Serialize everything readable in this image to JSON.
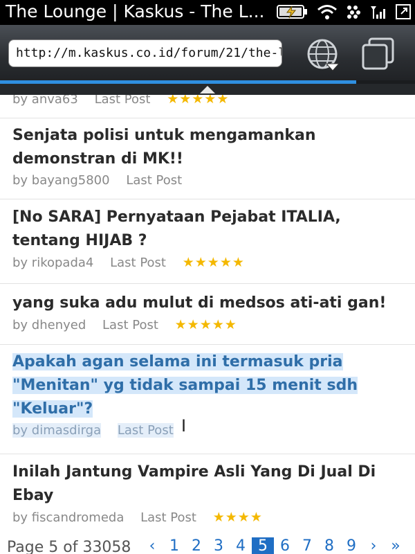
{
  "statusbar": {
    "title": "The Lounge | Kaskus - The L..."
  },
  "addressbar": {
    "url": "http://m.kaskus.co.id/forum/21/the-loun..."
  },
  "threads": [
    {
      "title": "",
      "author": "by anva63",
      "last_post": "Last Post",
      "stars": "★★★★★"
    },
    {
      "title": "Senjata polisi untuk mengamankan demonstran di MK!!",
      "author": "by bayang5800",
      "last_post": "Last Post",
      "stars": ""
    },
    {
      "title": "[No SARA] Pernyataan Pejabat ITALIA, tentang HIJAB ?",
      "author": "by rikopada4",
      "last_post": "Last Post",
      "stars": "★★★★★"
    },
    {
      "title": "yang suka adu mulut di medsos ati-ati gan!",
      "author": "by dhenyed",
      "last_post": "Last Post",
      "stars": "★★★★★"
    },
    {
      "title": "Apakah agan selama ini termasuk pria \"Menitan\" yg tidak sampai 15 menit sdh \"Keluar\"?",
      "author": "by dimasdirga",
      "last_post": "Last Post",
      "stars": ""
    },
    {
      "title": "Inilah Jantung Vampire Asli Yang Di Jual Di Ebay",
      "author": "by fiscandromeda",
      "last_post": "Last Post",
      "stars": "★★★★"
    }
  ],
  "pager": {
    "label": "Page 5 of 33058",
    "prev": "‹",
    "pages": [
      "1",
      "2",
      "3",
      "4",
      "5",
      "6",
      "7",
      "8",
      "9"
    ],
    "current": "5",
    "next": "›",
    "last": "»"
  },
  "colors": {
    "accent": "#2f8fe0",
    "star": "#f4b800",
    "highlight": "#d4e7fa"
  }
}
